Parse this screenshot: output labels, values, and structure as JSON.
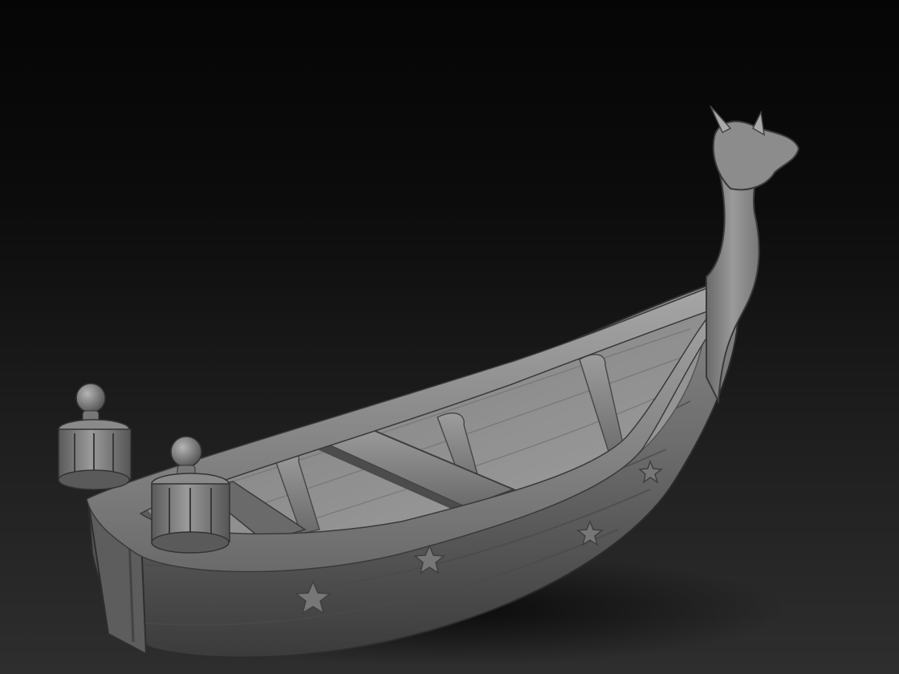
{
  "scene": {
    "subject": "sculpted-boat-model",
    "colors": {
      "background_top": "#050505",
      "background_bottom": "#2e2e2e",
      "clay_light": "#9a9a9a",
      "clay_mid": "#6f6f6f",
      "clay_dark": "#3a3a3a",
      "shadow": "#0a0a0a"
    }
  }
}
